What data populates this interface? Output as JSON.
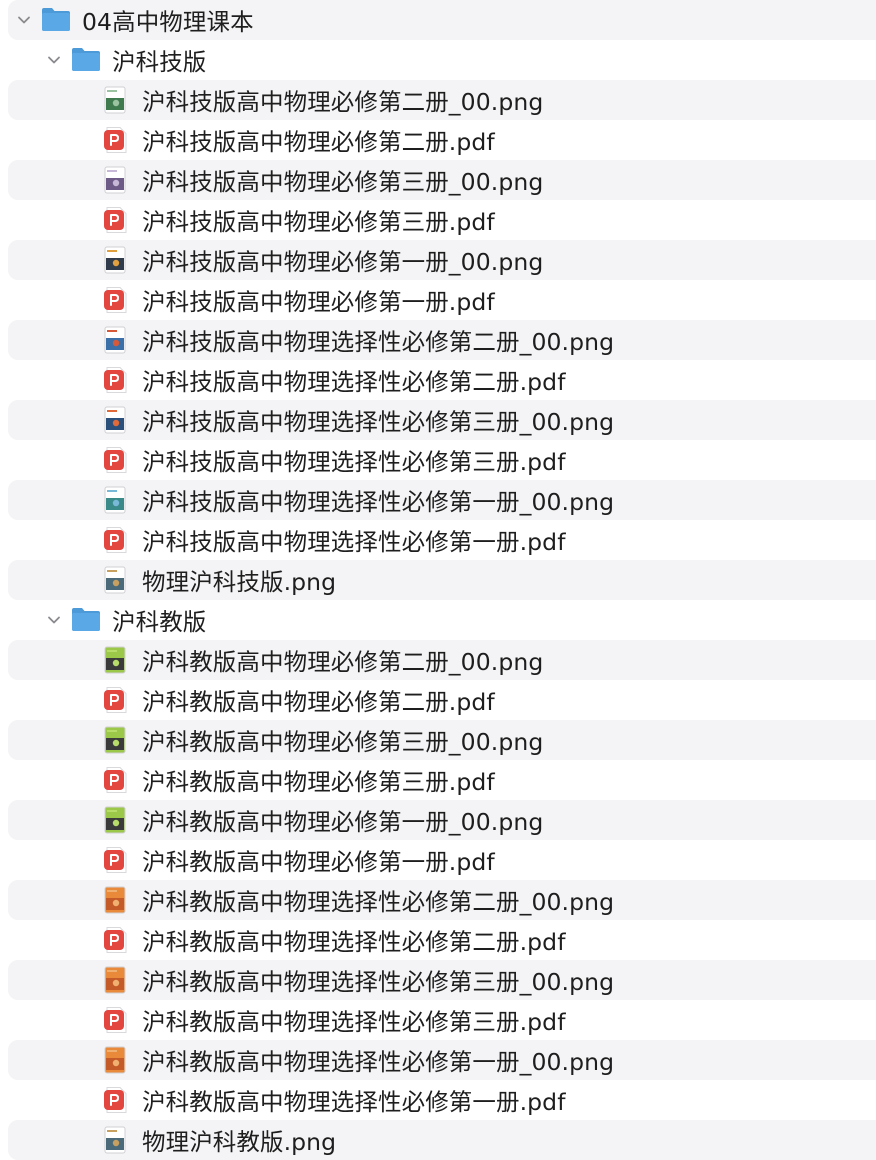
{
  "root": {
    "name": "04高中物理课本",
    "expanded": true,
    "icon": "folder-icon",
    "folders": [
      {
        "name": "沪科技版",
        "expanded": true,
        "icon": "folder-icon",
        "files": [
          {
            "name": "沪科技版高中物理必修第二册_00.png",
            "icon": "image-thumbnail-icon",
            "theme": "green-cover"
          },
          {
            "name": "沪科技版高中物理必修第二册.pdf",
            "icon": "pdf-icon"
          },
          {
            "name": "沪科技版高中物理必修第三册_00.png",
            "icon": "image-thumbnail-icon",
            "theme": "purple-cover"
          },
          {
            "name": "沪科技版高中物理必修第三册.pdf",
            "icon": "pdf-icon"
          },
          {
            "name": "沪科技版高中物理必修第一册_00.png",
            "icon": "image-thumbnail-icon",
            "theme": "dark-cover"
          },
          {
            "name": "沪科技版高中物理必修第一册.pdf",
            "icon": "pdf-icon"
          },
          {
            "name": "沪科技版高中物理选择性必修第二册_00.png",
            "icon": "image-thumbnail-icon",
            "theme": "blue-cover"
          },
          {
            "name": "沪科技版高中物理选择性必修第二册.pdf",
            "icon": "pdf-icon"
          },
          {
            "name": "沪科技版高中物理选择性必修第三册_00.png",
            "icon": "image-thumbnail-icon",
            "theme": "navy-cover"
          },
          {
            "name": "沪科技版高中物理选择性必修第三册.pdf",
            "icon": "pdf-icon"
          },
          {
            "name": "沪科技版高中物理选择性必修第一册_00.png",
            "icon": "image-thumbnail-icon",
            "theme": "teal-cover"
          },
          {
            "name": "沪科技版高中物理选择性必修第一册.pdf",
            "icon": "pdf-icon"
          },
          {
            "name": "物理沪科技版.png",
            "icon": "image-thumbnail-icon",
            "theme": "grid-cover"
          }
        ]
      },
      {
        "name": "沪科教版",
        "expanded": true,
        "icon": "folder-icon",
        "files": [
          {
            "name": "沪科教版高中物理必修第二册_00.png",
            "icon": "image-thumbnail-icon",
            "theme": "lime-cover"
          },
          {
            "name": "沪科教版高中物理必修第二册.pdf",
            "icon": "pdf-icon"
          },
          {
            "name": "沪科教版高中物理必修第三册_00.png",
            "icon": "image-thumbnail-icon",
            "theme": "lime-cover"
          },
          {
            "name": "沪科教版高中物理必修第三册.pdf",
            "icon": "pdf-icon"
          },
          {
            "name": "沪科教版高中物理必修第一册_00.png",
            "icon": "image-thumbnail-icon",
            "theme": "lime-cover"
          },
          {
            "name": "沪科教版高中物理必修第一册.pdf",
            "icon": "pdf-icon"
          },
          {
            "name": "沪科教版高中物理选择性必修第二册_00.png",
            "icon": "image-thumbnail-icon",
            "theme": "orange-cover"
          },
          {
            "name": "沪科教版高中物理选择性必修第二册.pdf",
            "icon": "pdf-icon"
          },
          {
            "name": "沪科教版高中物理选择性必修第三册_00.png",
            "icon": "image-thumbnail-icon",
            "theme": "orange-cover"
          },
          {
            "name": "沪科教版高中物理选择性必修第三册.pdf",
            "icon": "pdf-icon"
          },
          {
            "name": "沪科教版高中物理选择性必修第一册_00.png",
            "icon": "image-thumbnail-icon",
            "theme": "orange-cover"
          },
          {
            "name": "沪科教版高中物理选择性必修第一册.pdf",
            "icon": "pdf-icon"
          },
          {
            "name": "物理沪科教版.png",
            "icon": "image-thumbnail-icon",
            "theme": "grid-cover"
          }
        ]
      }
    ]
  },
  "colors": {
    "row_stripe": "#f4f4f6",
    "folder_blue": "#5aa9e6",
    "folder_tab": "#4d9ad8",
    "pdf_red": "#e2463f",
    "chevron": "#8a8a8e",
    "text": "#1e1e1e"
  },
  "thumbnail_themes": {
    "green-cover": {
      "top": "#ffffff",
      "band": "#3f7a4f",
      "accent": "#9cc3a1"
    },
    "purple-cover": {
      "top": "#ffffff",
      "band": "#6e5a86",
      "accent": "#c8b8d8"
    },
    "dark-cover": {
      "top": "#ffffff",
      "band": "#2f3a4a",
      "accent": "#e0a040"
    },
    "blue-cover": {
      "top": "#ffffff",
      "band": "#3b6fa8",
      "accent": "#d65a3a"
    },
    "navy-cover": {
      "top": "#ffffff",
      "band": "#2a4f7a",
      "accent": "#e06a3a"
    },
    "teal-cover": {
      "top": "#ffffff",
      "band": "#3a8a8a",
      "accent": "#7ab8d8"
    },
    "grid-cover": {
      "top": "#ffffff",
      "band": "#4a6a7a",
      "accent": "#c8a060"
    },
    "lime-cover": {
      "top": "#9cc84a",
      "band": "#3a3a3a",
      "accent": "#b8dc6a"
    },
    "orange-cover": {
      "top": "#e88a3a",
      "band": "#c45a28",
      "accent": "#f0b070"
    }
  }
}
